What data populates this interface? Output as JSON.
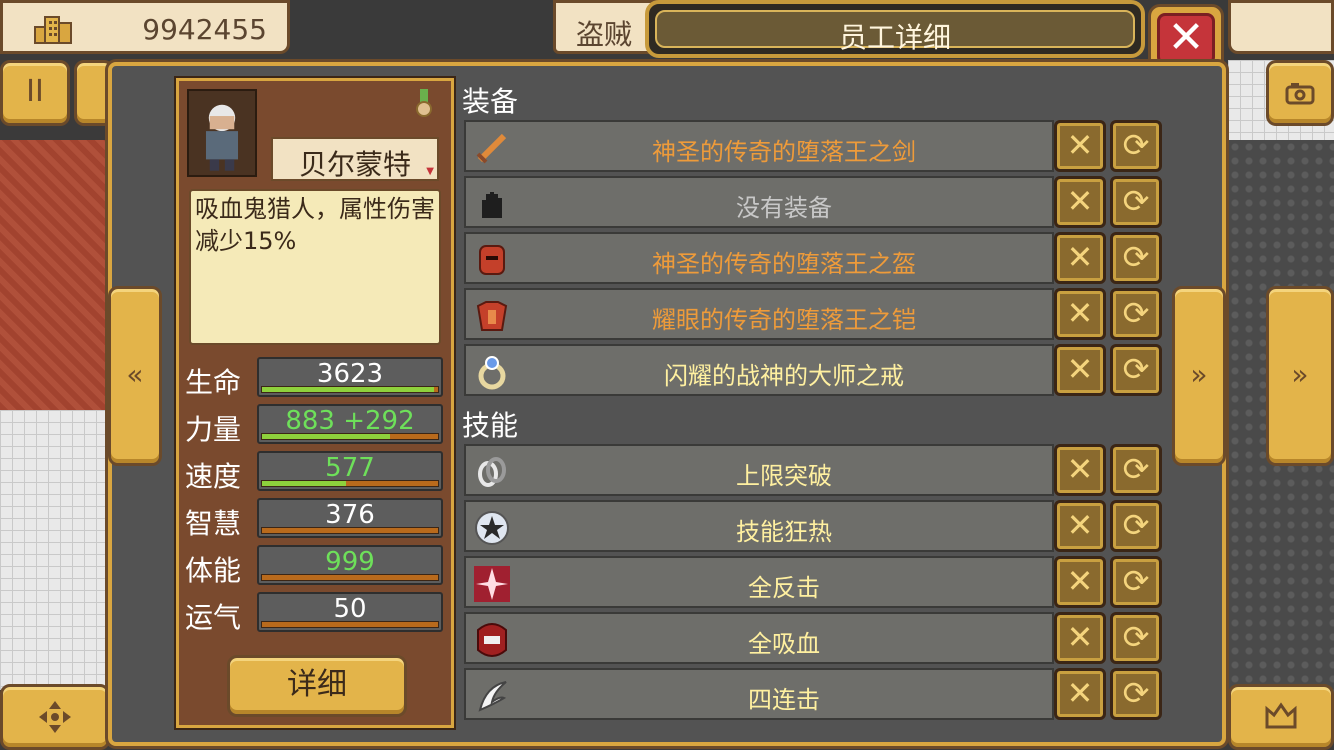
{
  "header": {
    "money": "9942455",
    "money_icon": "building-icon",
    "thief_tab": "盗贼",
    "title": "员工详细",
    "close_icon": "✕"
  },
  "buttons": {
    "pause": "II",
    "detail": "详细",
    "prev": "«",
    "next": "»",
    "far_next": "»",
    "remove_glyph": "✕",
    "swap_glyph": "⟳"
  },
  "character": {
    "name": "贝尔蒙特",
    "description": "吸血鬼猎人，属性伤害减少15%",
    "stats": [
      {
        "label": "生命",
        "value": "3623",
        "fill": 0.98,
        "color": "white"
      },
      {
        "label": "力量",
        "value": "883 +292",
        "fill": 0.73,
        "color": "green"
      },
      {
        "label": "速度",
        "value": "577",
        "fill": 0.48,
        "color": "green"
      },
      {
        "label": "智慧",
        "value": "376",
        "fill": 0.0,
        "color": "white"
      },
      {
        "label": "体能",
        "value": "999",
        "fill": 0.0,
        "color": "green"
      },
      {
        "label": "运气",
        "value": "50",
        "fill": 0.0,
        "color": "white"
      }
    ]
  },
  "equipment": {
    "title": "装备",
    "items": [
      {
        "name": "神圣的传奇的堕落王之剑",
        "icon": "sword-icon",
        "color": "orange"
      },
      {
        "name": "没有装备",
        "icon": "glove-icon",
        "color": "gray"
      },
      {
        "name": "神圣的传奇的堕落王之盔",
        "icon": "helmet-icon",
        "color": "orange"
      },
      {
        "name": "耀眼的传奇的堕落王之铠",
        "icon": "armor-icon",
        "color": "orange"
      },
      {
        "name": "闪耀的战神的大师之戒",
        "icon": "ring-icon",
        "color": "yellow"
      }
    ]
  },
  "skills": {
    "title": "技能",
    "items": [
      {
        "name": "上限突破",
        "icon": "chain-icon"
      },
      {
        "name": "技能狂热",
        "icon": "star-orb-icon"
      },
      {
        "name": "全反击",
        "icon": "burst-icon"
      },
      {
        "name": "全吸血",
        "icon": "fang-icon"
      },
      {
        "name": "四连击",
        "icon": "claw-icon"
      }
    ]
  }
}
